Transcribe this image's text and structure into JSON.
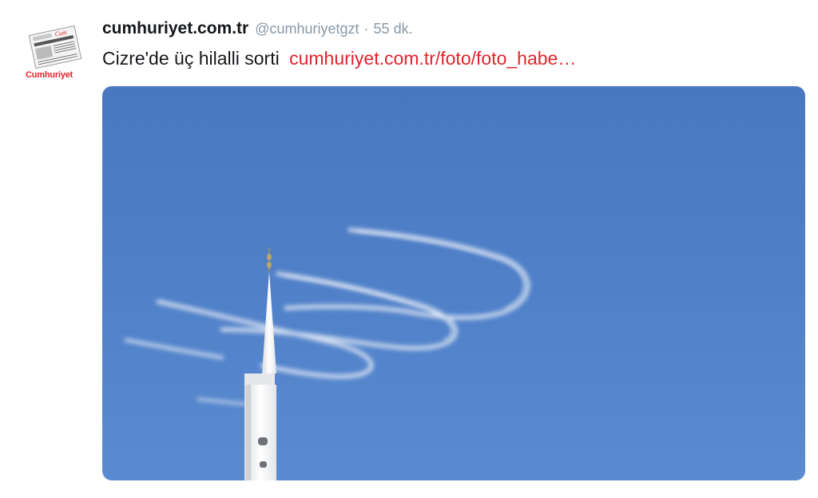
{
  "tweet": {
    "avatar": {
      "icon": "newspaper-logo-icon",
      "brand": "Cumhuriyet"
    },
    "display_name": "cumhuriyet.com.tr",
    "handle": "@cumhuriyetgzt",
    "separator": "·",
    "time": "55 dk.",
    "text": "Cizre'de üç hilalli sorti",
    "link": "cumhuriyet.com.tr/foto/foto_habe…",
    "media": {
      "description_icon": "photo-minaret-contrails",
      "colors": {
        "sky": "#4f7fc7",
        "minaret": "#f2f2f0",
        "link": "#e0242c"
      }
    }
  }
}
